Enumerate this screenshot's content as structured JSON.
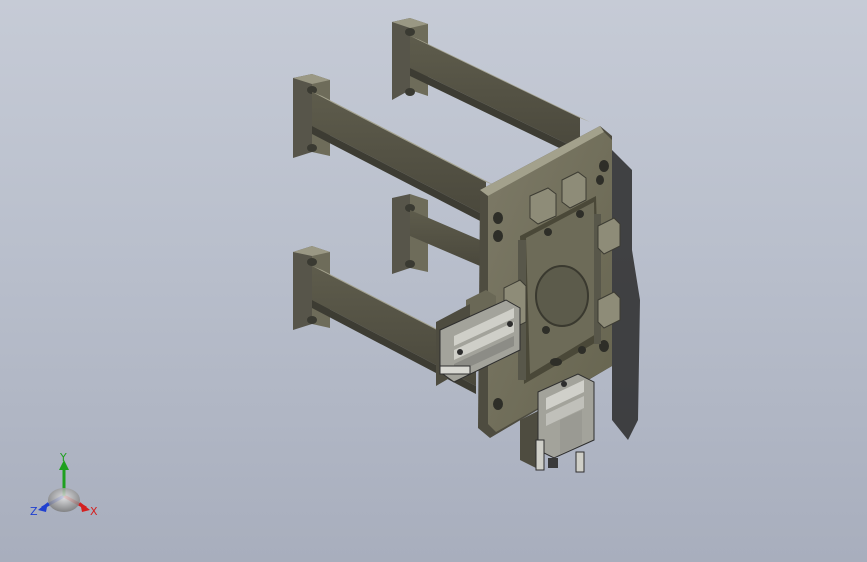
{
  "viewport": {
    "background_top": "#c6cbd6",
    "background_bottom": "#a8aebd"
  },
  "model": {
    "part_color": "#7a7764",
    "shadow_color": "#2a2a2a"
  },
  "triad": {
    "x_label": "X",
    "y_label": "Y",
    "z_label": "Z",
    "x_color": "#d42020",
    "y_color": "#1fa01f",
    "z_color": "#2040d0"
  }
}
